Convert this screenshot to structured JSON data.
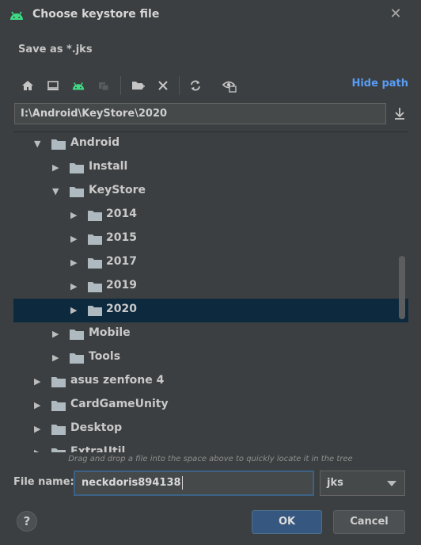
{
  "window": {
    "title": "Choose keystore file",
    "close": "✕"
  },
  "subtitle": "Save as *.jks",
  "toolbar": {
    "icons": [
      "home-icon",
      "desktop-icon",
      "android-icon",
      "module-icon",
      "new-folder-icon",
      "delete-icon",
      "refresh-icon",
      "show-hidden-icon"
    ],
    "hide_path_label": "Hide path"
  },
  "path": {
    "value": "I:\\Android\\KeyStore\\2020"
  },
  "tree": {
    "items": [
      {
        "label": "Android",
        "expanded": true,
        "level": 0
      },
      {
        "label": "Install",
        "expanded": false,
        "level": 1
      },
      {
        "label": "KeyStore",
        "expanded": true,
        "level": 1
      },
      {
        "label": "2014",
        "expanded": false,
        "level": 2
      },
      {
        "label": "2015",
        "expanded": false,
        "level": 2
      },
      {
        "label": "2017",
        "expanded": false,
        "level": 2
      },
      {
        "label": "2019",
        "expanded": false,
        "level": 2
      },
      {
        "label": "2020",
        "expanded": false,
        "level": 2,
        "selected": true
      },
      {
        "label": "Mobile",
        "expanded": false,
        "level": 1
      },
      {
        "label": "Tools",
        "expanded": false,
        "level": 1
      },
      {
        "label": "asus zenfone 4",
        "expanded": false,
        "level": 0
      },
      {
        "label": "CardGameUnity",
        "expanded": false,
        "level": 0
      },
      {
        "label": "Desktop",
        "expanded": false,
        "level": 0
      },
      {
        "label": "ExtraUtil",
        "expanded": false,
        "level": 0
      }
    ]
  },
  "hint": "Drag and drop a file into the space above to quickly locate it in the tree",
  "file_name": {
    "label": "File name:",
    "value": "neckdoris894138"
  },
  "extension": {
    "selected": "jks"
  },
  "buttons": {
    "help": "?",
    "ok": "OK",
    "cancel": "Cancel"
  },
  "colors": {
    "accent": "#589df6",
    "android_green": "#3ddc84",
    "selection": "#0d293e",
    "ok_bg": "#365880"
  }
}
